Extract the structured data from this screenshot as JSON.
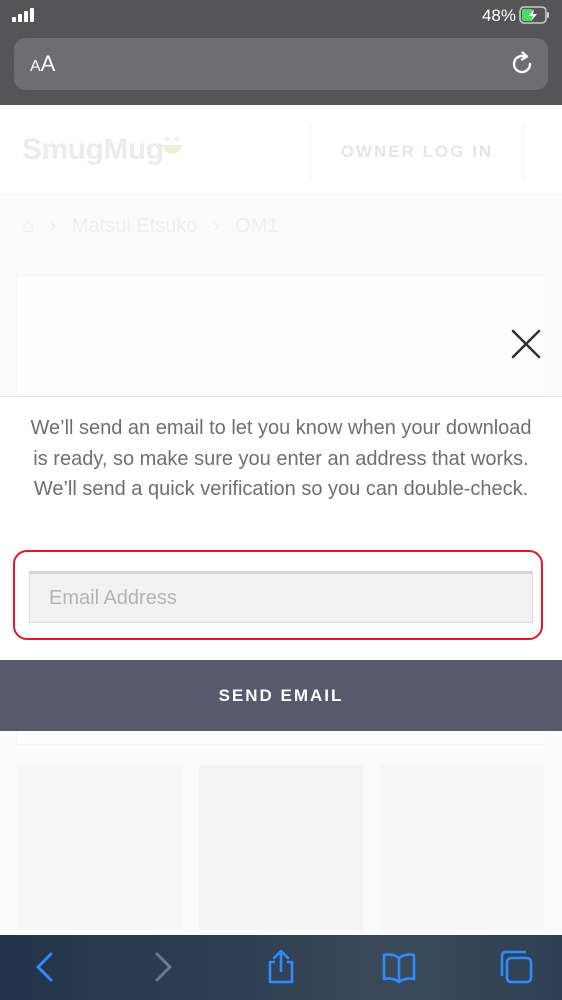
{
  "status_bar": {
    "battery_percent": "48%",
    "battery_level": 0.48,
    "battery_color": "#4cd964"
  },
  "url_bar": {
    "text_size_label": "AA",
    "reload_icon": "reload-icon"
  },
  "site": {
    "logo_text": "SmugMug",
    "owner_login_label": "OWNER LOG IN",
    "breadcrumb": [
      "Matsui Etsuko",
      "OM1"
    ]
  },
  "modal": {
    "message": "We’ll send an email to let you know when your download is ready, so make sure you enter an address that works. We’ll send a quick verification so you can double-check.",
    "email_placeholder": "Email Address",
    "email_value": "",
    "send_button_label": "SEND EMAIL",
    "highlight_color": "#e0182e",
    "button_color": "#555b6d"
  },
  "toolbar": {
    "icons": [
      "back-icon",
      "forward-icon",
      "share-icon",
      "bookmarks-icon",
      "tabs-icon"
    ],
    "accent_color": "#2f8cff"
  }
}
